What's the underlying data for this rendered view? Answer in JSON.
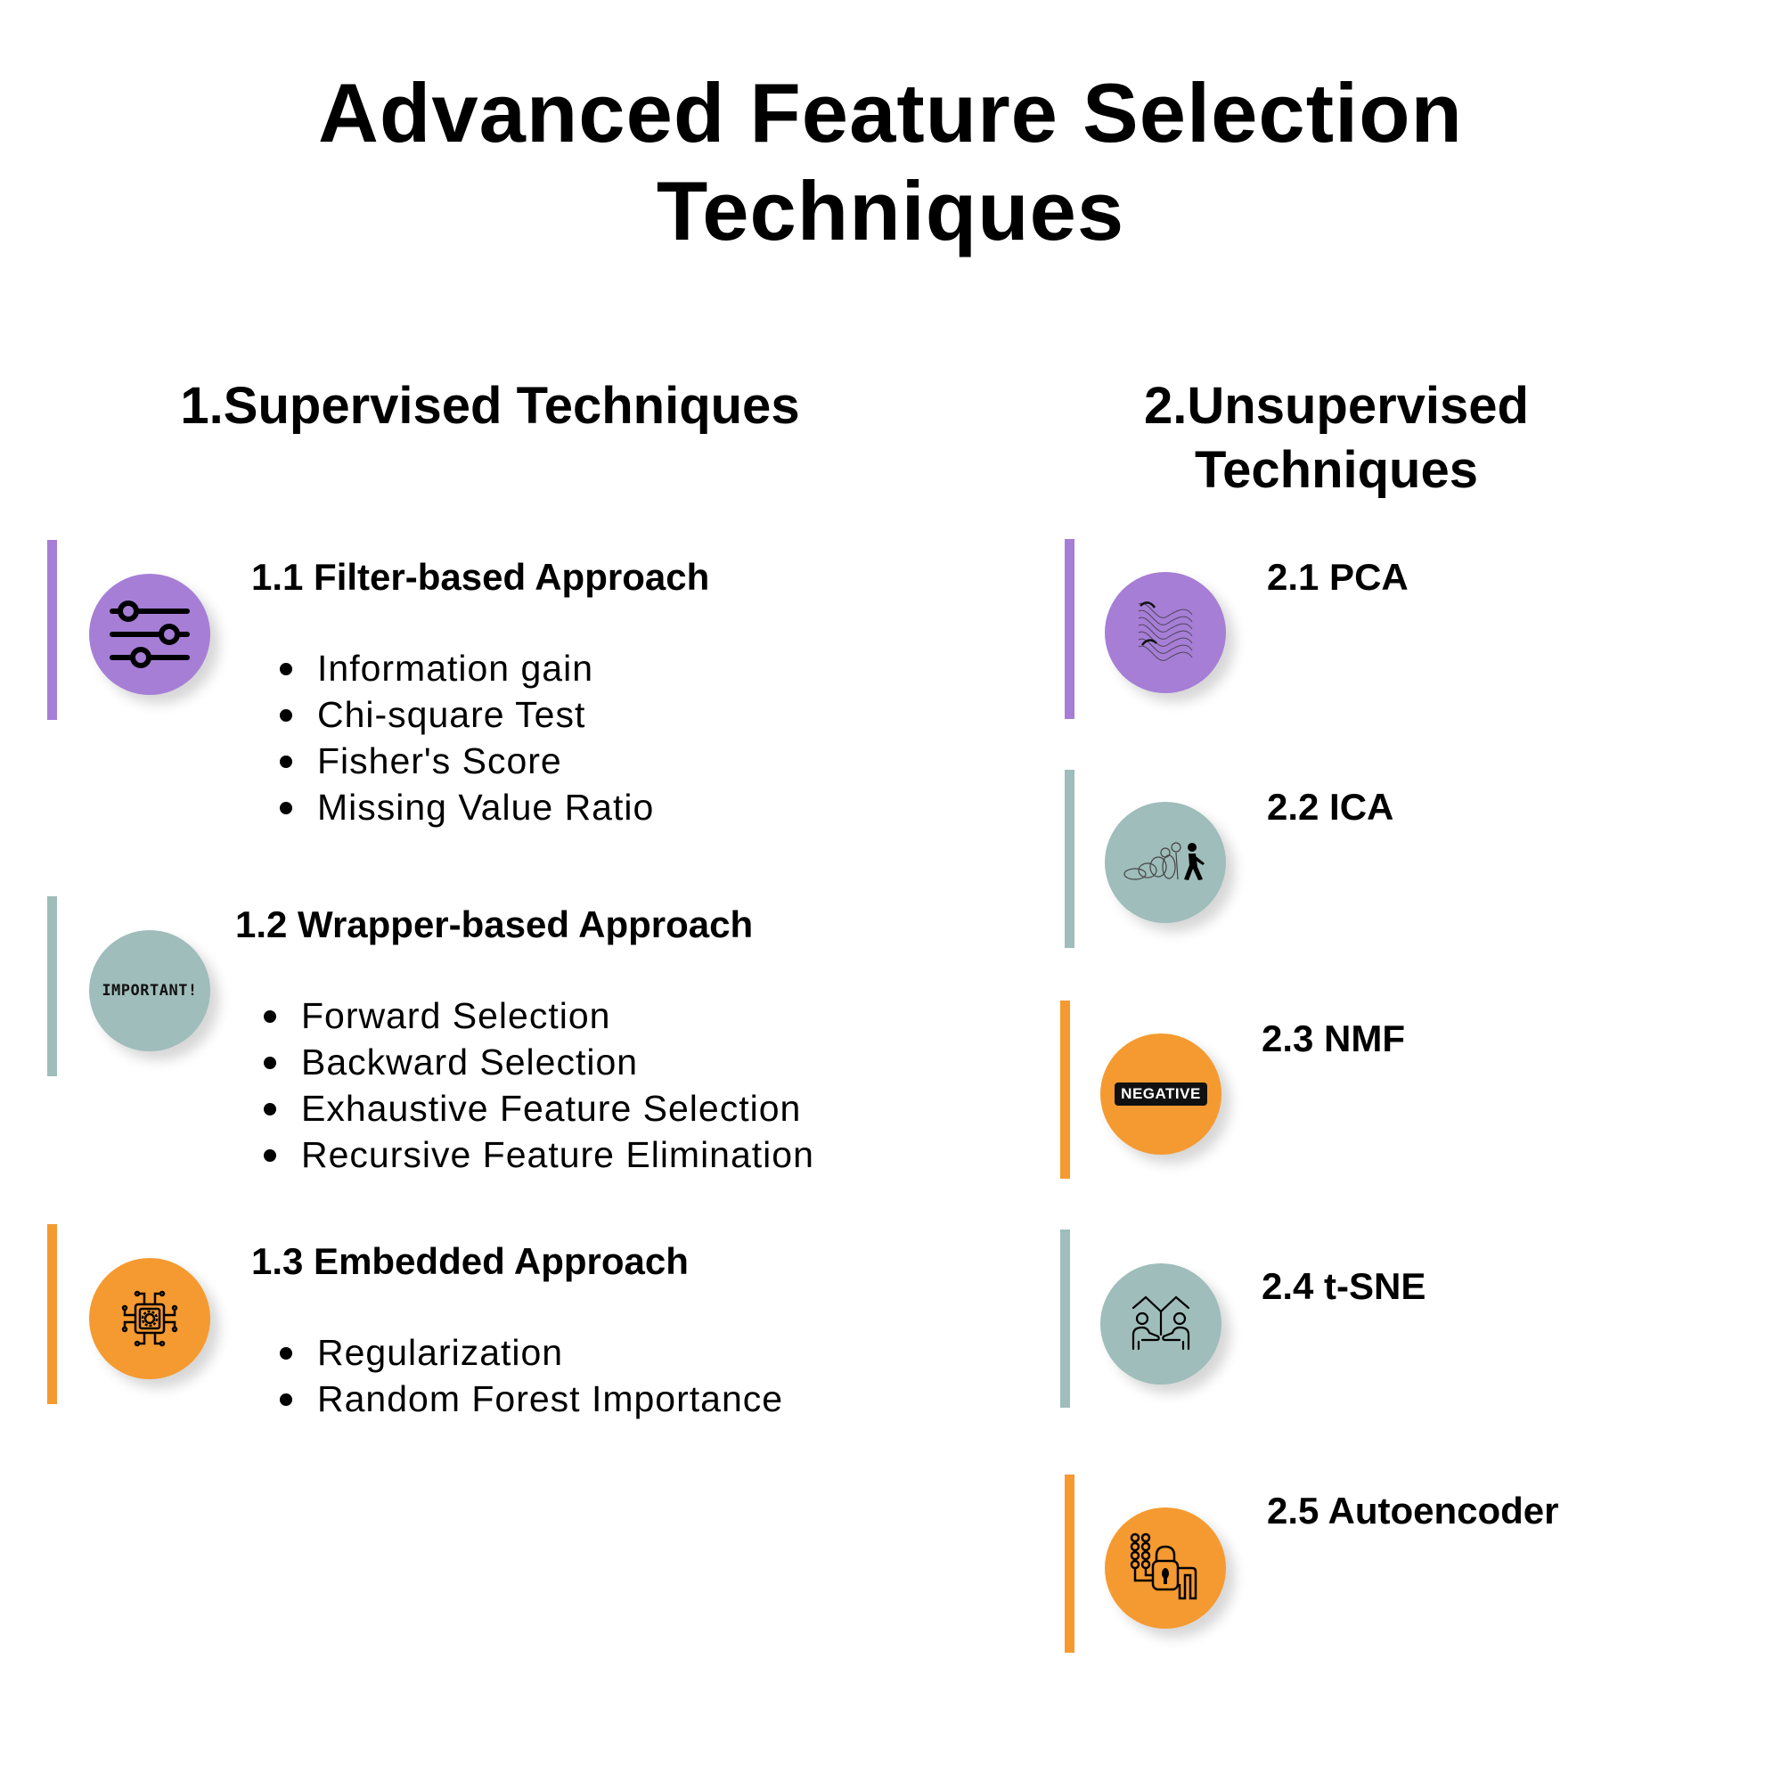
{
  "title_line1": "Advanced Feature Selection",
  "title_line2": "Techniques",
  "colors": {
    "purple": "#A67ED6",
    "teal": "#9FBDBA",
    "orange": "#F59A30",
    "text": "#000000"
  },
  "supervised": {
    "heading": "1.Supervised Techniques",
    "groups": [
      {
        "title": "1.1 Filter-based Approach",
        "icon": "sliders-icon",
        "color": "purple",
        "items": [
          "Information gain",
          "Chi-square Test",
          "Fisher's Score",
          "Missing Value Ratio"
        ]
      },
      {
        "title": "1.2 Wrapper-based Approach",
        "icon": "important-text-icon",
        "icon_text": "IMPORTANT!",
        "color": "teal",
        "items": [
          "Forward Selection",
          "Backward Selection",
          "Exhaustive Feature Selection",
          "Recursive Feature Elimination"
        ]
      },
      {
        "title": "1.3 Embedded Approach",
        "icon": "chip-gear-icon",
        "color": "orange",
        "items": [
          "Regularization",
          "Random Forest Importance"
        ]
      }
    ]
  },
  "unsupervised": {
    "heading_line1": "2.Unsupervised",
    "heading_line2": "Techniques",
    "groups": [
      {
        "title": "2.1 PCA",
        "icon": "wave-surface-icon",
        "color": "purple"
      },
      {
        "title": "2.2 ICA",
        "icon": "evolution-walk-icon",
        "color": "teal"
      },
      {
        "title": "2.3 NMF",
        "icon": "negative-badge-icon",
        "icon_text": "NEGATIVE",
        "color": "orange"
      },
      {
        "title": "2.4 t-SNE",
        "icon": "people-split-icon",
        "color": "teal"
      },
      {
        "title": "2.5 Autoencoder",
        "icon": "lock-circuit-icon",
        "color": "orange"
      }
    ]
  }
}
